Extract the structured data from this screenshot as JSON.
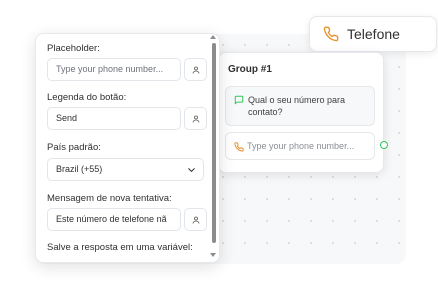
{
  "chip": {
    "label": "Telefone",
    "icon": "phone-icon",
    "accent": "#e8902c"
  },
  "group": {
    "title": "Group #1",
    "message": "Qual o seu número para contato?",
    "input_preview": "Type your phone number..."
  },
  "settings": {
    "placeholder_label": "Placeholder:",
    "placeholder_value": "Type your phone number...",
    "button_label_label": "Legenda do botão:",
    "button_label_value": "Send",
    "country_label": "País padrão:",
    "country_value": "Brazil (+55)",
    "retry_label": "Mensagem de nova tentativa:",
    "retry_value": "Este número de telefone nã",
    "save_variable_label": "Salve a resposta em uma variável:"
  },
  "colors": {
    "accent_orange": "#e8902c",
    "accent_green": "#34c759"
  }
}
